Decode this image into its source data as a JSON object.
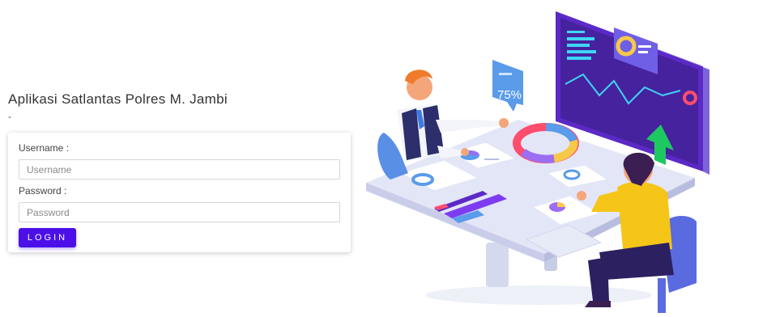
{
  "app": {
    "title": "Aplikasi Satlantas Polres M. Jambi",
    "subtitle": "-"
  },
  "login_form": {
    "username_label": "Username :",
    "username_placeholder": "Username",
    "username_value": "",
    "password_label": "Password :",
    "password_placeholder": "Password",
    "password_value": "",
    "login_button": "LOGIN"
  },
  "illustration": {
    "percent_badge": "75%",
    "accent_color": "#4b10e8",
    "icons": [
      "business-meeting-illustration"
    ]
  }
}
